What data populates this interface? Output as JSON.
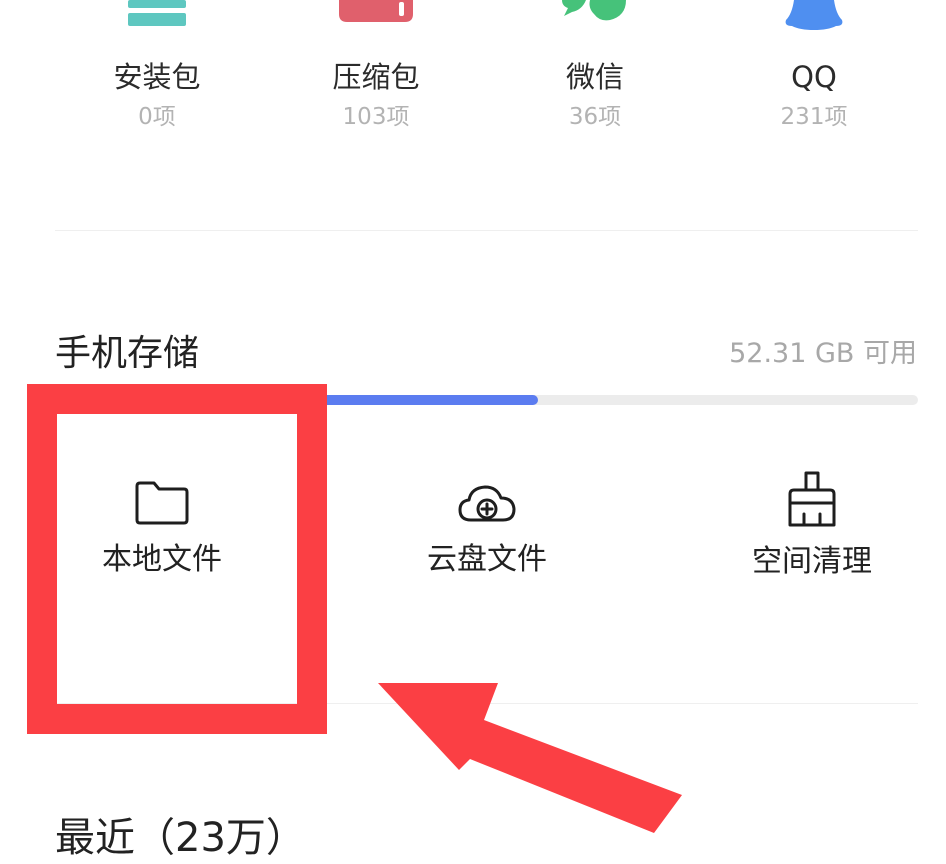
{
  "categories": [
    {
      "name": "安装包",
      "count": "0项",
      "icon": "package-icon",
      "color": "#5ec7c0"
    },
    {
      "name": "压缩包",
      "count": "103项",
      "icon": "archive-icon",
      "color": "#e0606c"
    },
    {
      "name": "微信",
      "count": "36项",
      "icon": "wechat-icon",
      "color": "#46c27a"
    },
    {
      "name": "QQ",
      "count": "231项",
      "icon": "qq-icon",
      "color": "#4f8ff0"
    }
  ],
  "storage": {
    "title": "手机存储",
    "available": "52.31 GB 可用",
    "used_fraction": 0.56,
    "bar_color": "#5b7cf0"
  },
  "tools": [
    {
      "label": "本地文件",
      "icon": "folder-icon"
    },
    {
      "label": "云盘文件",
      "icon": "cloud-upload-icon"
    },
    {
      "label": "空间清理",
      "icon": "broom-icon"
    }
  ],
  "recent": {
    "title": "最近（23万）"
  },
  "annotation": {
    "box_color": "#fb3f44",
    "arrow_color": "#fb3f44"
  }
}
